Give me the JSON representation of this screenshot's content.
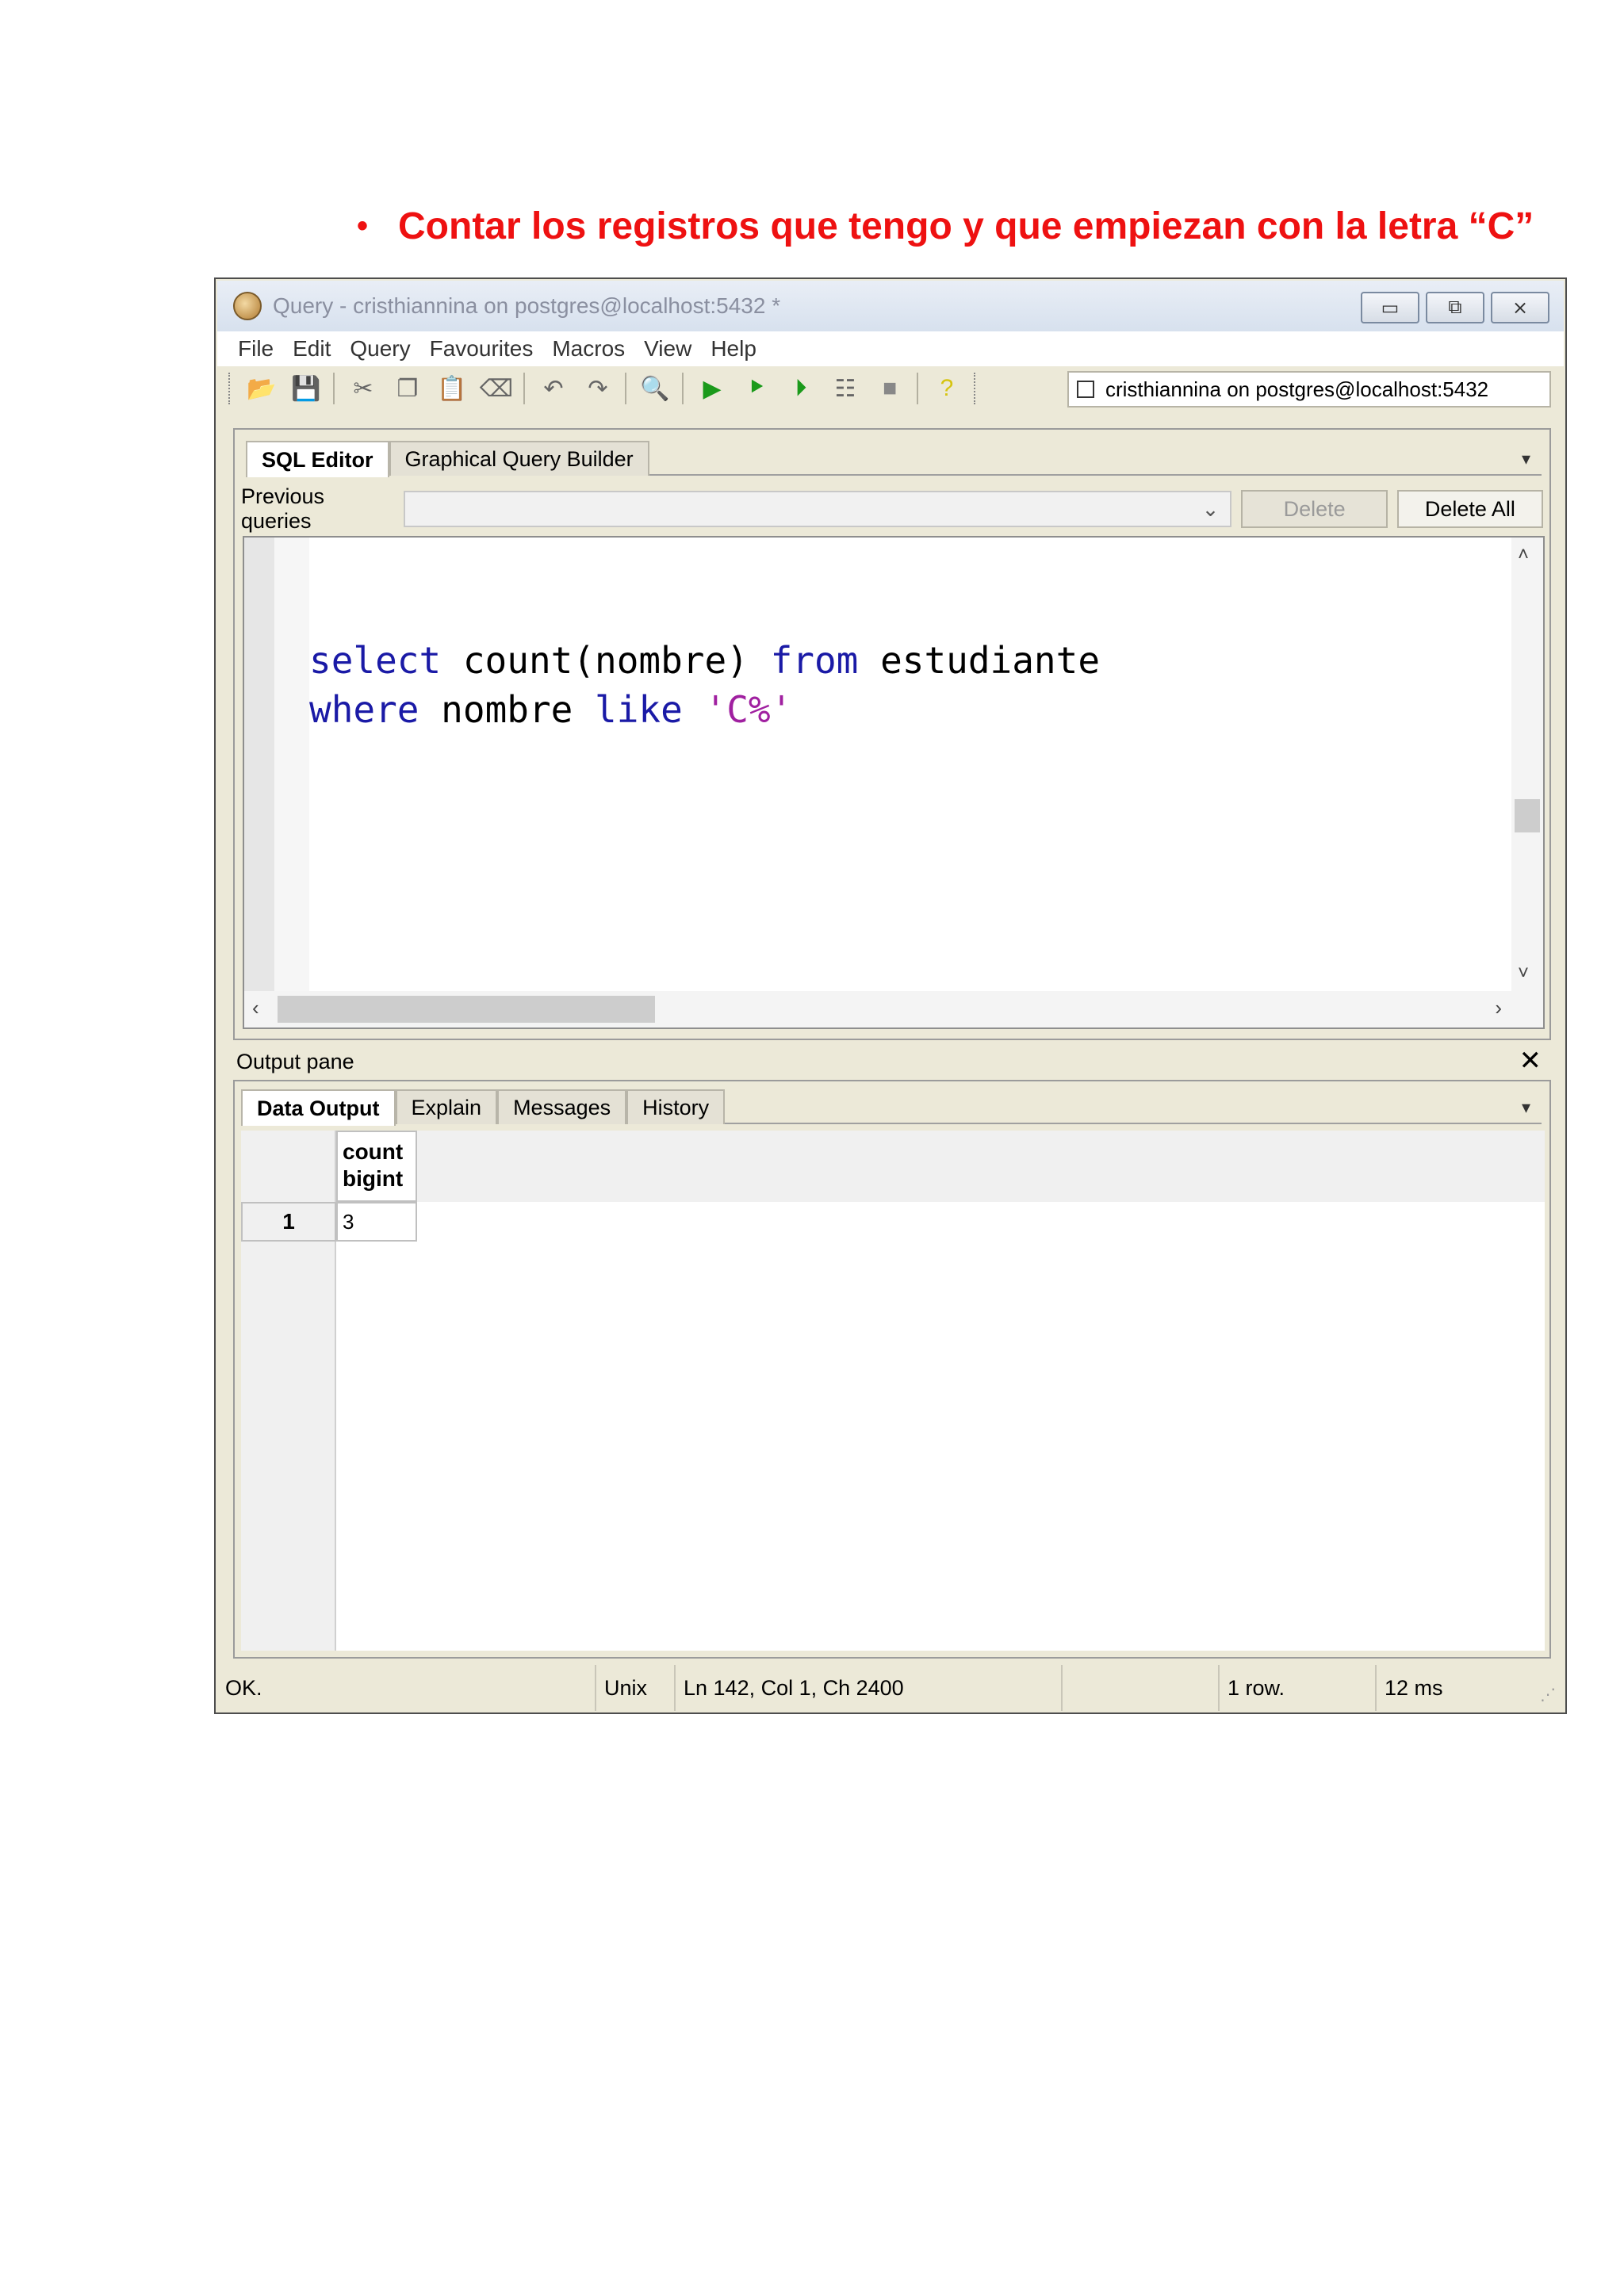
{
  "heading": {
    "bullet": "•",
    "text": "Contar los registros que tengo y que empiezan con la letra “C”"
  },
  "window": {
    "title": "Query - cristhiannina on postgres@localhost:5432 *",
    "controls": {
      "minimize": "▭",
      "maximize": "⧉",
      "close": "⨯"
    }
  },
  "menu": [
    "File",
    "Edit",
    "Query",
    "Favourites",
    "Macros",
    "View",
    "Help"
  ],
  "toolbar": {
    "icons": [
      "folder-open-icon",
      "save-icon",
      "cut-icon",
      "copy-icon",
      "paste-icon",
      "eraser-icon",
      "undo-icon",
      "redo-icon",
      "find-icon",
      "execute-icon",
      "explain-icon",
      "execute-to-file-icon",
      "explain-analyze-icon",
      "stop-icon",
      "help-icon"
    ],
    "connection": "cristhiannina on postgres@localhost:5432"
  },
  "editor": {
    "tabs": [
      "SQL Editor",
      "Graphical Query Builder"
    ],
    "previous_queries_label": "Previous queries",
    "delete_label": "Delete",
    "delete_all_label": "Delete All",
    "code": {
      "line1": {
        "select": "select",
        "mid": " count(nombre) ",
        "from": "from",
        "rest": " estudiante"
      },
      "line2": {
        "where": "where",
        "mid": " nombre ",
        "like": "like",
        "space": " ",
        "str": "'C%'"
      }
    }
  },
  "output": {
    "title": "Output pane",
    "close": "✕",
    "tabs": [
      "Data Output",
      "Explain",
      "Messages",
      "History"
    ],
    "columns": [
      {
        "name": "count",
        "type": "bigint"
      }
    ],
    "rows": [
      {
        "num": "1",
        "values": [
          "3"
        ]
      }
    ]
  },
  "status": {
    "state": "OK.",
    "line_endings": "Unix",
    "position": "Ln 142, Col 1, Ch 2400",
    "rows": "1 row.",
    "time": "12 ms"
  }
}
